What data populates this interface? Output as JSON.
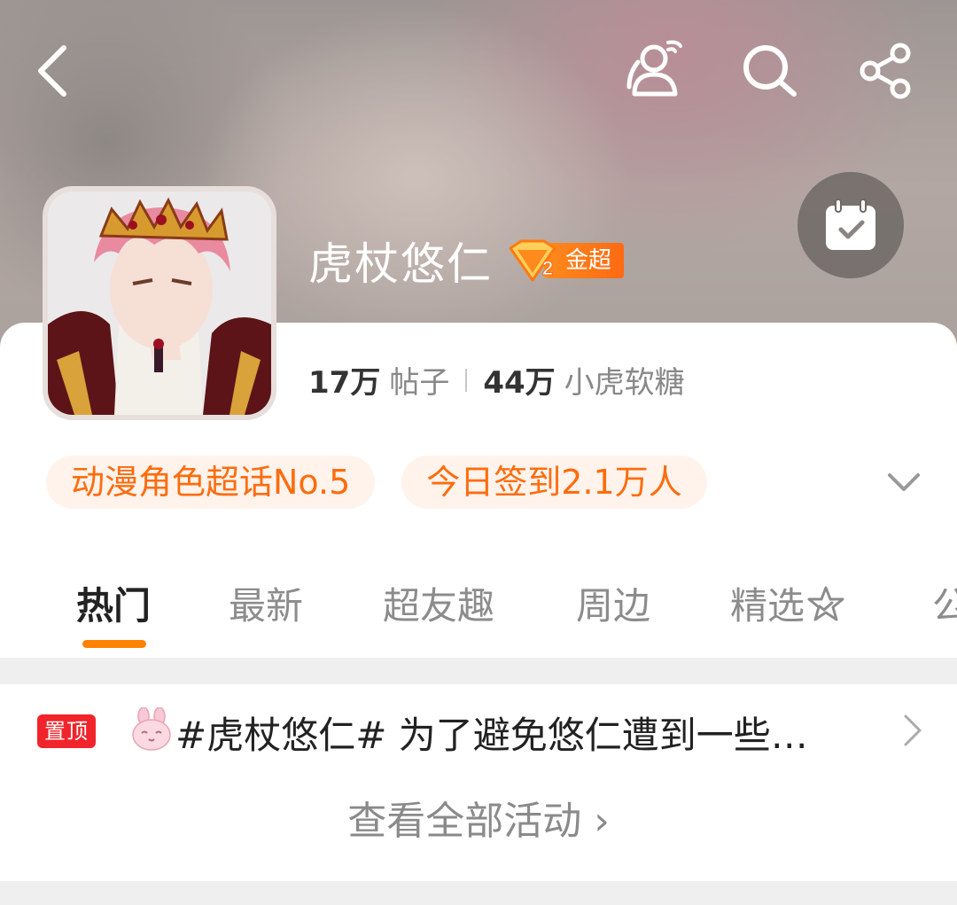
{
  "topbar": {
    "back_icon": "chevron-left-icon",
    "people_icon": "people-icon",
    "search_icon": "search-icon",
    "share_icon": "share-icon"
  },
  "checkin": {
    "icon": "calendar-check-icon"
  },
  "profile": {
    "title": "虎杖悠仁",
    "level_number": "2",
    "level_label": "金超",
    "posts_count": "17万",
    "posts_label": "帖子",
    "followers_count": "44万",
    "followers_label": "小虎软糖"
  },
  "tags": [
    {
      "label": "动漫角色超话No.5"
    },
    {
      "label": "今日签到2.1万人"
    }
  ],
  "tabs": [
    {
      "label": "热门",
      "active": true
    },
    {
      "label": "最新"
    },
    {
      "label": "超友趣"
    },
    {
      "label": "周边"
    },
    {
      "label": "精选"
    },
    {
      "label": "公"
    }
  ],
  "activity": {
    "pin_label": "置顶",
    "text": "#虎杖悠仁#  为了避免悠仁遭到一些…",
    "view_all": "查看全部活动 ›"
  },
  "colors": {
    "accent": "#ff8200",
    "tag_text": "#ff6c0d",
    "tag_bg": "#fff3ec",
    "pin_red": "#f0242a"
  }
}
